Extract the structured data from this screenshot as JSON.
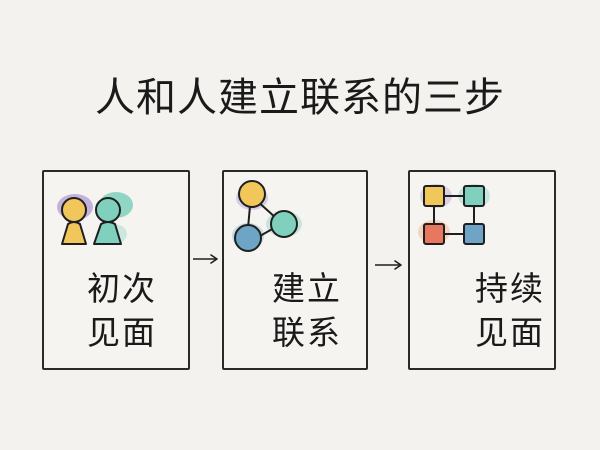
{
  "title": "人和人建立联系的三步",
  "steps": [
    {
      "line1": "初次",
      "line2": "见面"
    },
    {
      "line1": "建立",
      "line2": "联系"
    },
    {
      "line1": "持续",
      "line2": "见面"
    }
  ],
  "colors": {
    "yellow": "#f1c75b",
    "teal": "#7fd0bd",
    "blue": "#6ea5c6",
    "orange": "#ef9f6e",
    "red": "#e7785f",
    "purple": "#b8a6d8",
    "ink": "#1f1f1f"
  },
  "icons": [
    "two-people-icon",
    "network-nodes-icon",
    "grid-network-icon"
  ]
}
